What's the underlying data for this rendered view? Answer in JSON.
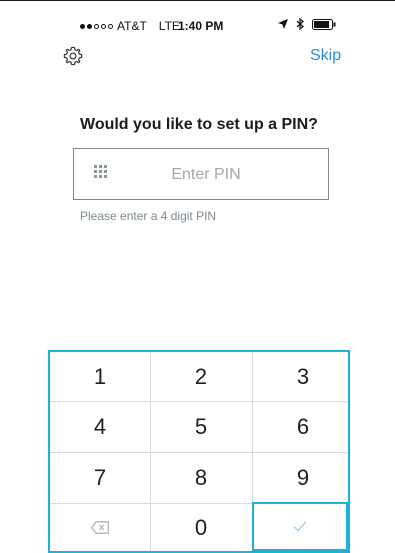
{
  "status_bar": {
    "carrier": "AT&T",
    "network": "LTE",
    "time": "1:40 PM"
  },
  "header": {
    "settings_icon": "gear-icon",
    "skip_label": "Skip"
  },
  "main": {
    "question": "Would you like to set up a PIN?",
    "pin_input": {
      "placeholder": "Enter PIN",
      "value": ""
    },
    "hint": "Please enter a 4 digit PIN"
  },
  "keypad": {
    "keys": [
      "1",
      "2",
      "3",
      "4",
      "5",
      "6",
      "7",
      "8",
      "9",
      "",
      "0",
      ""
    ],
    "delete_icon": "backspace-icon",
    "confirm_icon": "checkmark-icon"
  },
  "colors": {
    "accent": "#1eb2d8",
    "link": "#2a8cd4",
    "hint": "#7b8a90"
  }
}
